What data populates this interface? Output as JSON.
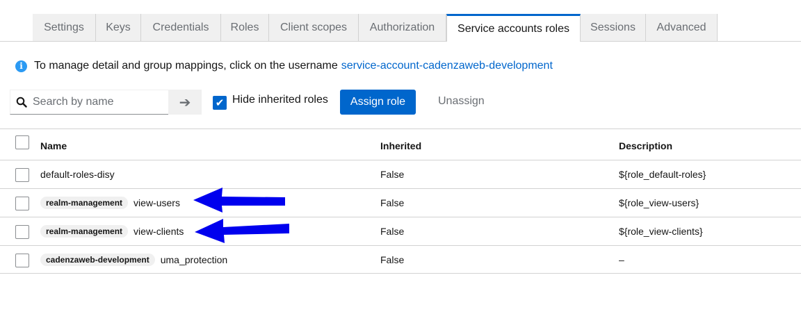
{
  "tabs": [
    {
      "label": "Settings"
    },
    {
      "label": "Keys"
    },
    {
      "label": "Credentials"
    },
    {
      "label": "Roles"
    },
    {
      "label": "Client scopes"
    },
    {
      "label": "Authorization"
    },
    {
      "label": "Service accounts roles",
      "active": true
    },
    {
      "label": "Sessions"
    },
    {
      "label": "Advanced"
    }
  ],
  "info": {
    "icon": "info-circle-icon",
    "text": "To manage detail and group mappings, click on the username",
    "link": "service-account-cadenzaweb-development"
  },
  "toolbar": {
    "search_placeholder": "Search by name",
    "hide_inherited_label": "Hide inherited roles",
    "hide_inherited_checked": true,
    "assign_label": "Assign role",
    "unassign_label": "Unassign"
  },
  "table": {
    "headers": {
      "name": "Name",
      "inherited": "Inherited",
      "description": "Description"
    },
    "rows": [
      {
        "client": "",
        "name": "default-roles-disy",
        "inherited": "False",
        "description": "${role_default-roles}"
      },
      {
        "client": "realm-management",
        "name": "view-users",
        "inherited": "False",
        "description": "${role_view-users}"
      },
      {
        "client": "realm-management",
        "name": "view-clients",
        "inherited": "False",
        "description": "${role_view-clients}"
      },
      {
        "client": "cadenzaweb-development",
        "name": "uma_protection",
        "inherited": "False",
        "description": "–"
      }
    ]
  },
  "colors": {
    "accent": "#0066cc",
    "annotation_arrow": "#0000ee"
  }
}
